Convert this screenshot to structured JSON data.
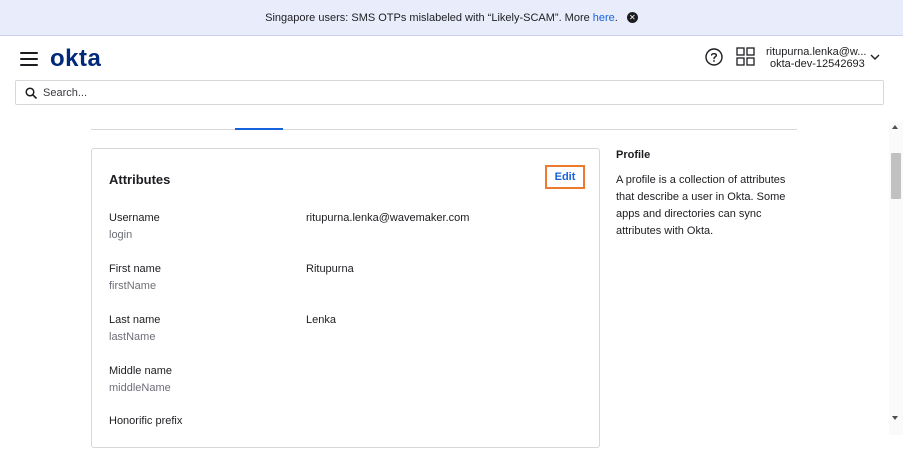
{
  "banner": {
    "text": "Singapore users: SMS OTPs mislabeled with “Likely-SCAM”. More",
    "link": "here",
    "period": ".",
    "close_icon": "close-circle-icon"
  },
  "header": {
    "logo": "okta",
    "menu_icon": "hamburger-menu-icon",
    "help_icon": "help-circle-icon",
    "apps_icon": "app-grid-icon",
    "user_email": "ritupurna.lenka@w...",
    "user_org": "okta-dev-12542693",
    "user_menu_icon": "chevron-down-icon"
  },
  "search": {
    "placeholder": "Search...",
    "value": "",
    "icon": "search-icon"
  },
  "attributes": {
    "title": "Attributes",
    "edit_label": "Edit",
    "rows": [
      {
        "label": "Username",
        "key": "login",
        "value": "ritupurna.lenka@wavemaker.com"
      },
      {
        "label": "First name",
        "key": "firstName",
        "value": "Ritupurna"
      },
      {
        "label": "Last name",
        "key": "lastName",
        "value": "Lenka"
      },
      {
        "label": "Middle name",
        "key": "middleName",
        "value": ""
      },
      {
        "label": "Honorific prefix",
        "key": "",
        "value": ""
      }
    ]
  },
  "profile_help": {
    "title": "Profile",
    "description": "A profile is a collection of attributes that describe a user in Okta. Some apps and directories can sync attributes with Okta."
  },
  "colors": {
    "accent": "#1662dd",
    "logo": "#00297a",
    "highlight_border": "#ec7a2f",
    "banner_bg": "#e9edfb"
  }
}
